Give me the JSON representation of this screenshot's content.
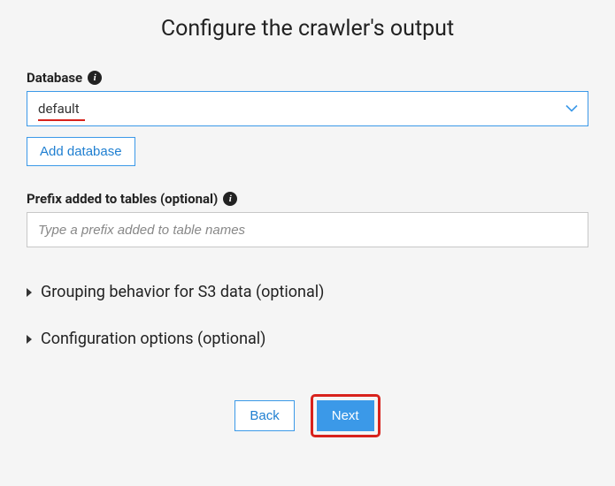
{
  "title": "Configure the crawler's output",
  "database": {
    "label": "Database",
    "value": "default",
    "add_button_label": "Add database"
  },
  "prefix": {
    "label": "Prefix added to tables (optional)",
    "placeholder": "Type a prefix added to table names"
  },
  "sections": {
    "grouping": "Grouping behavior for S3 data (optional)",
    "config": "Configuration options (optional)"
  },
  "buttons": {
    "back": "Back",
    "next": "Next"
  }
}
